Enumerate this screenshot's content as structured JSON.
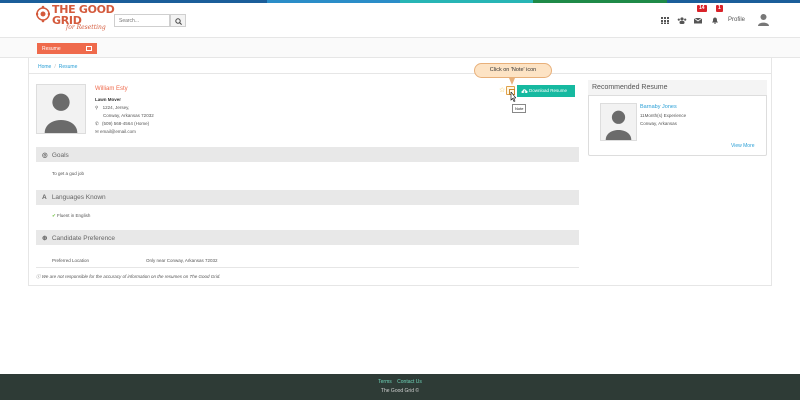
{
  "colors": {
    "brand": "#ef6a4c",
    "accent_teal": "#16b9a0",
    "link": "#2a9fd6",
    "badge": "#d9232a",
    "footer_bg": "#2e3b36"
  },
  "header": {
    "logo_text_line1": "THE GOOD",
    "logo_text_line2": "GRID",
    "logo_tagline": "for Resetting",
    "search_placeholder": "Search...",
    "icons": [
      "apps-grid-icon",
      "users-icon",
      "mail-icon",
      "bell-icon"
    ],
    "mail_badge": "14",
    "bell_badge": "1",
    "profile_label": "Profile"
  },
  "subnav": {
    "active_tab": "Resume"
  },
  "breadcrumb": {
    "home": "Home",
    "separator": "/",
    "current": "Resume"
  },
  "candidate": {
    "name": "William Esty",
    "title": "Lawn Mover",
    "address_line1": "1224, Jersey,",
    "address_line2": "Conway, Arkansas 72032",
    "phone": "(509) 568-4564 (Home)",
    "email": "email@email.com"
  },
  "actions": {
    "download_label": "Download Resume",
    "note_tooltip": "Note",
    "callout": "Click on 'Note' icon"
  },
  "sections": {
    "goals": {
      "title": "Goals",
      "body": "To get a gud job"
    },
    "languages": {
      "title": "Languages Known",
      "item": "Fluent in English"
    },
    "preference": {
      "title": "Candidate Preference",
      "label": "Preferred Location",
      "value": "Only near Conway, Arkansas 72032"
    }
  },
  "disclaimer": "We are not responsible for the accuracy of information on the resumes on The Good Grid.",
  "recommended": {
    "title": "Recommended Resume",
    "name": "Barnaby Jones",
    "experience": "11Month(s) Experience",
    "location": "Conway, Arkansas",
    "view_more": "View More"
  },
  "footer": {
    "terms": "Terms",
    "contact": "Contact Us",
    "copyright": "The Good Grid ©"
  }
}
